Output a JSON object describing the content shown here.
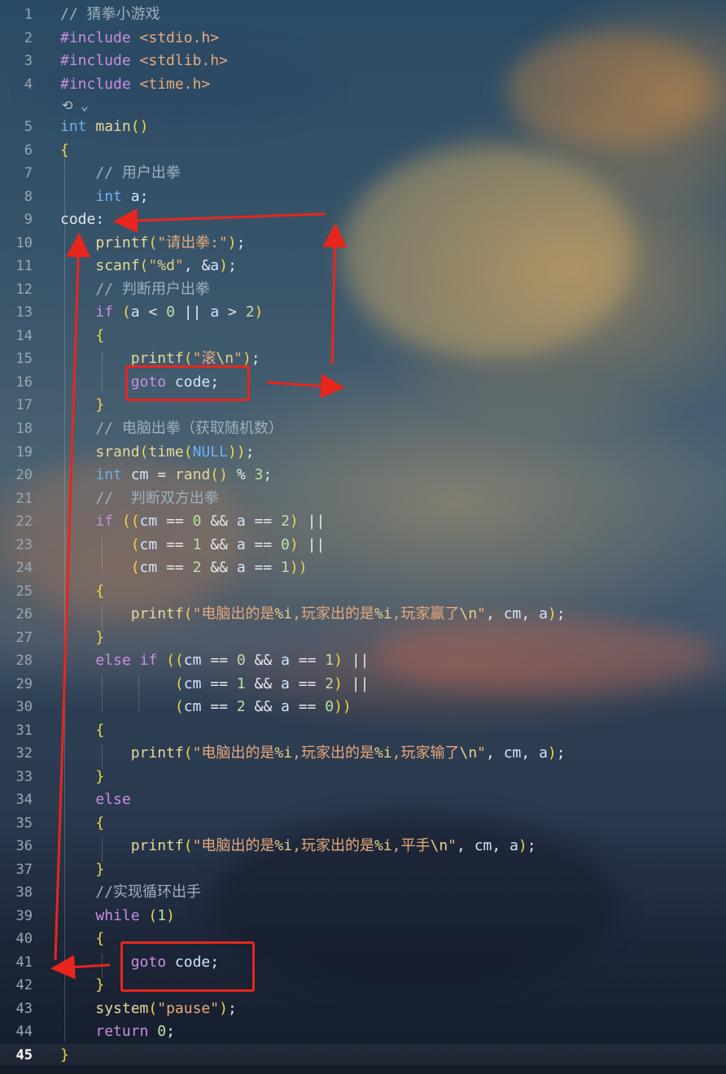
{
  "editor": {
    "codelens": "⟲ ⌄",
    "current_line": 45,
    "lines": [
      {
        "n": "1",
        "text": "// 猜拳小游戏"
      },
      {
        "n": "2",
        "text": "#include <stdio.h>"
      },
      {
        "n": "3",
        "text": "#include <stdlib.h>"
      },
      {
        "n": "4",
        "text": "#include <time.h>"
      },
      {
        "n": "5",
        "text": "int main()"
      },
      {
        "n": "6",
        "text": "{"
      },
      {
        "n": "7",
        "text": "    // 用户出拳"
      },
      {
        "n": "8",
        "text": "    int a;"
      },
      {
        "n": "9",
        "text": "code:"
      },
      {
        "n": "10",
        "text": "    printf(\"请出拳:\");"
      },
      {
        "n": "11",
        "text": "    scanf(\"%d\", &a);"
      },
      {
        "n": "12",
        "text": "    // 判断用户出拳"
      },
      {
        "n": "13",
        "text": "    if (a < 0 || a > 2)"
      },
      {
        "n": "14",
        "text": "    {"
      },
      {
        "n": "15",
        "text": "        printf(\"滚\\n\");"
      },
      {
        "n": "16",
        "text": "        goto code;"
      },
      {
        "n": "17",
        "text": "    }"
      },
      {
        "n": "18",
        "text": "    // 电脑出拳（获取随机数）"
      },
      {
        "n": "19",
        "text": "    srand(time(NULL));"
      },
      {
        "n": "20",
        "text": "    int cm = rand() % 3;"
      },
      {
        "n": "21",
        "text": "    //  判断双方出拳"
      },
      {
        "n": "22",
        "text": "    if ((cm == 0 && a == 2) ||"
      },
      {
        "n": "23",
        "text": "        (cm == 1 && a == 0) ||"
      },
      {
        "n": "24",
        "text": "        (cm == 2 && a == 1))"
      },
      {
        "n": "25",
        "text": "    {"
      },
      {
        "n": "26",
        "text": "        printf(\"电脑出的是%i,玩家出的是%i,玩家赢了\\n\", cm, a);"
      },
      {
        "n": "27",
        "text": "    }"
      },
      {
        "n": "28",
        "text": "    else if ((cm == 0 && a == 1) ||"
      },
      {
        "n": "29",
        "text": "             (cm == 1 && a == 2) ||"
      },
      {
        "n": "30",
        "text": "             (cm == 2 && a == 0))"
      },
      {
        "n": "31",
        "text": "    {"
      },
      {
        "n": "32",
        "text": "        printf(\"电脑出的是%i,玩家出的是%i,玩家输了\\n\", cm, a);"
      },
      {
        "n": "33",
        "text": "    }"
      },
      {
        "n": "34",
        "text": "    else"
      },
      {
        "n": "35",
        "text": "    {"
      },
      {
        "n": "36",
        "text": "        printf(\"电脑出的是%i,玩家出的是%i,平手\\n\", cm, a);"
      },
      {
        "n": "37",
        "text": "    }"
      },
      {
        "n": "38",
        "text": "    //实现循环出手"
      },
      {
        "n": "39",
        "text": "    while (1)"
      },
      {
        "n": "40",
        "text": "    {"
      },
      {
        "n": "41",
        "text": "        goto code;"
      },
      {
        "n": "42",
        "text": "    }"
      },
      {
        "n": "43",
        "text": "    system(\"pause\");"
      },
      {
        "n": "44",
        "text": "    return 0;"
      },
      {
        "n": "45",
        "text": "}"
      }
    ]
  },
  "annotation_color": "#e8261d"
}
